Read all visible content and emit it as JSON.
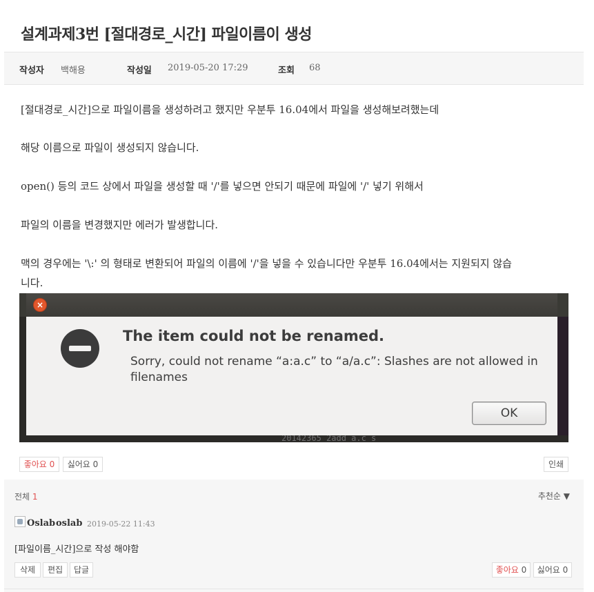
{
  "post": {
    "title": "설계과제3번 [절대경로_시간] 파일이름이 생성",
    "author_label": "작성자",
    "author": "백해용",
    "date_label": "작성일",
    "date": "2019-05-20 17:29",
    "views_label": "조회",
    "views": "68",
    "paragraphs": [
      "[절대경로_시간]으로 파일이름을 생성하려고 했지만 우분투 16.04에서 파일을 생성해보려했는데",
      "해당 이름으로 파일이 생성되지 않습니다.",
      "open() 등의 코드 상에서 파일을 생성할 때 '/'를 넣으면 안되기 때문에 파일에 '/' 넣기 위해서",
      "파일의 이름을 변경했지만 에러가 발생합니다.",
      "맥의 경우에는 '\\:' 의 형태로 변환되어 파일의 이름에 '/'을 넣을 수 있습니다만 우분투 16.04에서는 지원되지 않습",
      "니다."
    ]
  },
  "screenshot": {
    "close_glyph": "×",
    "heading": "The item could not be renamed.",
    "message": "Sorry, could not rename “a:a.c” to “a/a.c”: Slashes are not allowed in filenames",
    "ok_label": "OK",
    "bg_terminal_text": "20142365 2add  a.c  s"
  },
  "actions": {
    "like_label": "좋아요",
    "like_count": "0",
    "dislike_label": "싫어요",
    "dislike_count": "0",
    "print_label": "인쇄"
  },
  "comments": {
    "total_label": "전체",
    "total_count": "1",
    "sort_label": "추천순 ▼",
    "items": [
      {
        "avatar_alt": "Oslab",
        "author": "oslab",
        "date": "2019-05-22 11:43",
        "text": "[파일이름_시간]으로 작성 해야함",
        "delete_label": "삭제",
        "edit_label": "편집",
        "reply_label": "답글",
        "like_label": "좋아요",
        "like_count": "0",
        "dislike_label": "싫어요",
        "dislike_count": "0"
      }
    ]
  },
  "colors": {
    "accent_red": "#e05050",
    "meta_bg": "#f6f6f6",
    "dialog_bg": "#f2f1f0",
    "close_orange": "#e2572c"
  }
}
